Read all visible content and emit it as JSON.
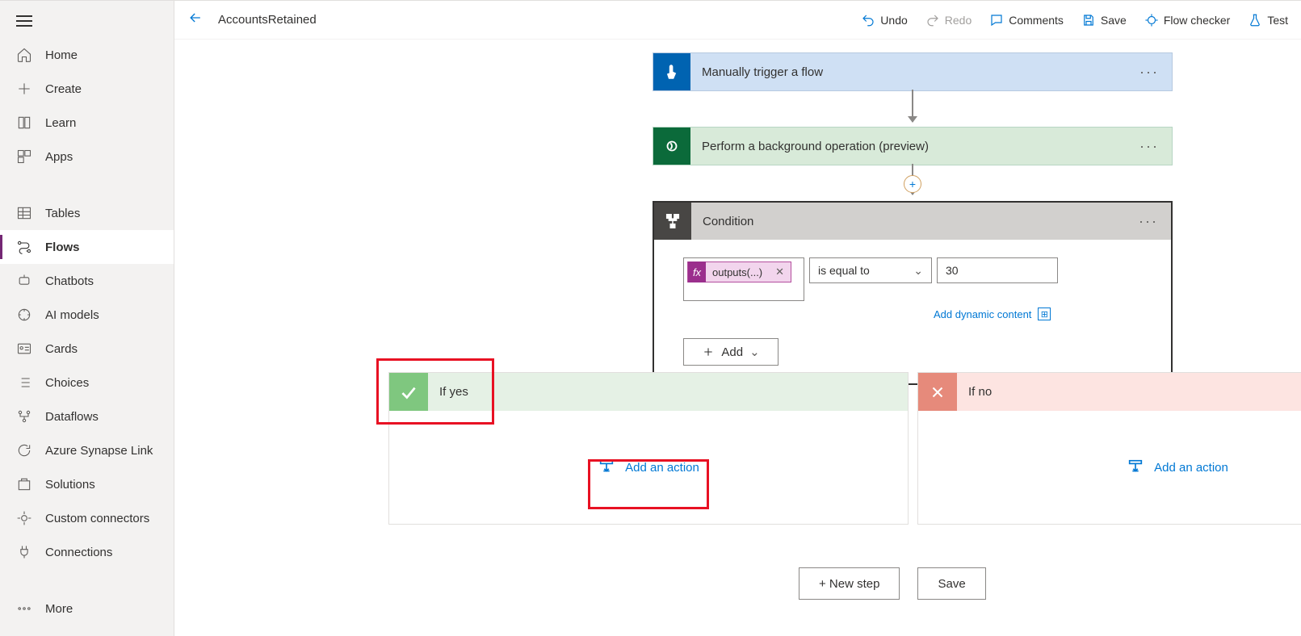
{
  "header": {
    "title": "AccountsRetained",
    "toolbar": {
      "undo": "Undo",
      "redo": "Redo",
      "comments": "Comments",
      "save": "Save",
      "flow_checker": "Flow checker",
      "test": "Test"
    }
  },
  "sidebar": {
    "groups": [
      {
        "items": [
          {
            "label": "Home",
            "icon": "home"
          },
          {
            "label": "Create",
            "icon": "plus"
          },
          {
            "label": "Learn",
            "icon": "book"
          },
          {
            "label": "Apps",
            "icon": "apps"
          }
        ]
      },
      {
        "items": [
          {
            "label": "Tables",
            "icon": "table"
          },
          {
            "label": "Flows",
            "icon": "flow",
            "active": true
          },
          {
            "label": "Chatbots",
            "icon": "chatbot"
          },
          {
            "label": "AI models",
            "icon": "ai"
          },
          {
            "label": "Cards",
            "icon": "card"
          },
          {
            "label": "Choices",
            "icon": "list"
          },
          {
            "label": "Dataflows",
            "icon": "dataflow"
          },
          {
            "label": "Azure Synapse Link",
            "icon": "sync"
          },
          {
            "label": "Solutions",
            "icon": "solution"
          },
          {
            "label": "Custom connectors",
            "icon": "connector"
          },
          {
            "label": "Connections",
            "icon": "plug"
          }
        ]
      },
      {
        "items": [
          {
            "label": "More",
            "icon": "more"
          }
        ]
      }
    ]
  },
  "flow": {
    "trigger": {
      "title": "Manually trigger a flow"
    },
    "action1": {
      "title": "Perform a background operation (preview)"
    },
    "condition": {
      "title": "Condition",
      "lhs_token": "outputs(...)",
      "operator": "is equal to",
      "rhs": "30",
      "dynamic": "Add dynamic content",
      "add": "Add"
    },
    "yes": {
      "title": "If yes",
      "add": "Add an action"
    },
    "no": {
      "title": "If no",
      "add": "Add an action"
    },
    "bottom": {
      "new_step": "+ New step",
      "save": "Save"
    }
  }
}
